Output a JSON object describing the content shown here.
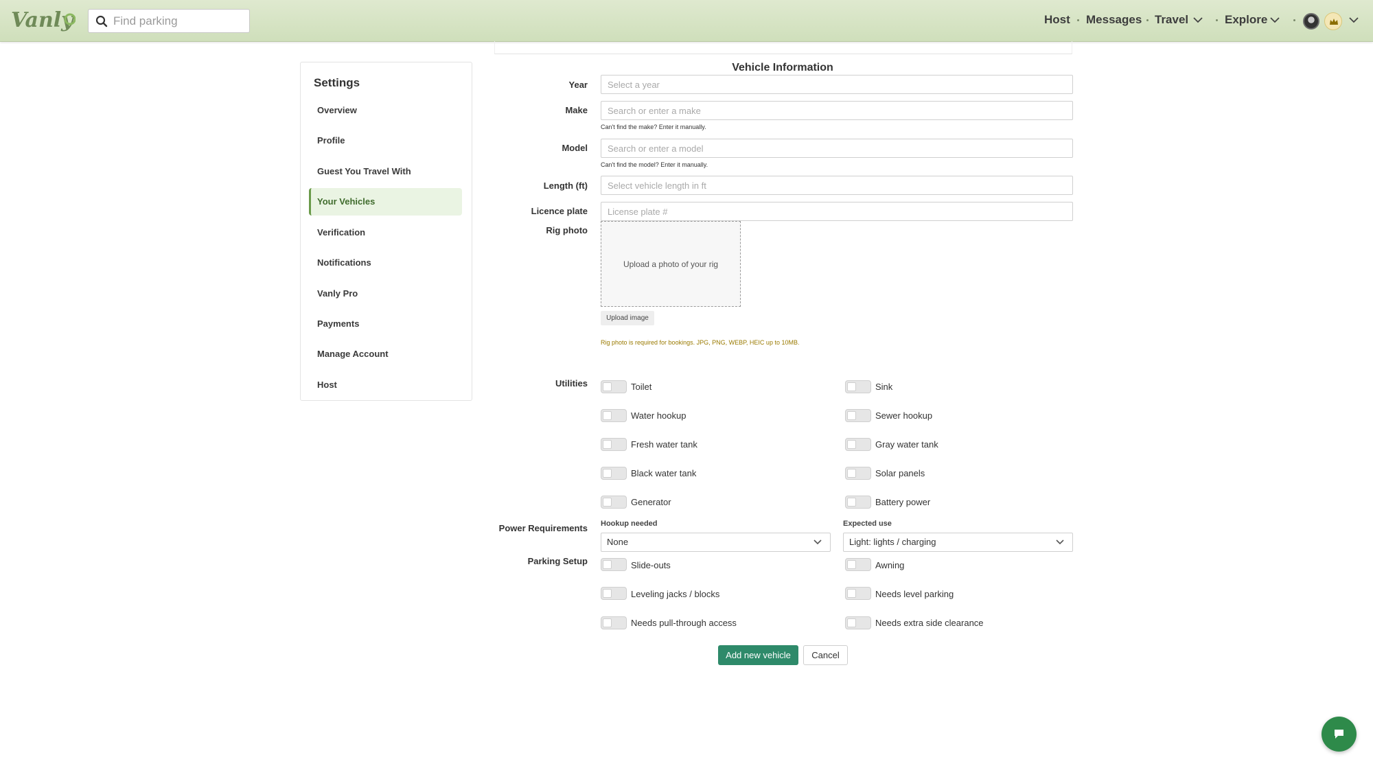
{
  "header": {
    "logo_text": "Vanly",
    "search_placeholder": "Find parking",
    "nav": {
      "host": "Host",
      "messages": "Messages",
      "travel": "Travel",
      "explore": "Explore"
    }
  },
  "sidebar": {
    "title": "Settings",
    "items": [
      {
        "label": "Overview",
        "active": false
      },
      {
        "label": "Profile",
        "active": false
      },
      {
        "label": "Guest You Travel With",
        "active": false
      },
      {
        "label": "Your Vehicles",
        "active": true
      },
      {
        "label": "Verification",
        "active": false
      },
      {
        "label": "Notifications",
        "active": false
      },
      {
        "label": "Vanly Pro",
        "active": false
      },
      {
        "label": "Payments",
        "active": false
      },
      {
        "label": "Manage Account",
        "active": false
      },
      {
        "label": "Host",
        "active": false
      }
    ]
  },
  "form": {
    "title": "Vehicle Information",
    "year": {
      "label": "Year",
      "placeholder": "Select a year"
    },
    "make": {
      "label": "Make",
      "placeholder": "Search or enter a make",
      "hint": "Can't find the make? Enter it manually."
    },
    "model": {
      "label": "Model",
      "placeholder": "Search or enter a model",
      "hint": "Can't find the model? Enter it manually."
    },
    "length": {
      "label": "Length (ft)",
      "placeholder": "Select vehicle length in ft"
    },
    "plate": {
      "label": "Licence plate",
      "placeholder": "License plate #"
    },
    "rig_photo": {
      "label": "Rig photo",
      "box_text": "Upload a photo of your rig",
      "button": "Upload image",
      "note": "Rig photo is required for bookings. JPG, PNG, WEBP, HEIC up to 10MB."
    },
    "utilities": {
      "label": "Utilities",
      "left": [
        "Toilet",
        "Water hookup",
        "Fresh water tank",
        "Black water tank",
        "Generator"
      ],
      "right": [
        "Sink",
        "Sewer hookup",
        "Gray water tank",
        "Solar panels",
        "Battery power"
      ]
    },
    "power": {
      "label": "Power Requirements",
      "hookup_label": "Hookup needed",
      "hookup_value": "None",
      "use_label": "Expected use",
      "use_value": "Light: lights / charging"
    },
    "parking": {
      "label": "Parking Setup",
      "left": [
        "Slide-outs",
        "Leveling jacks / blocks",
        "Needs pull-through access"
      ],
      "right": [
        "Awning",
        "Needs level parking",
        "Needs extra side clearance"
      ]
    },
    "buttons": {
      "add": "Add new vehicle",
      "cancel": "Cancel"
    }
  },
  "colors": {
    "header_bg": "#d6e5c4",
    "accent": "#2e8a6a",
    "active_nav_bg": "#eaf4e3",
    "warning_text": "#9a7a00",
    "chat_bubble": "#2e8a4a"
  }
}
